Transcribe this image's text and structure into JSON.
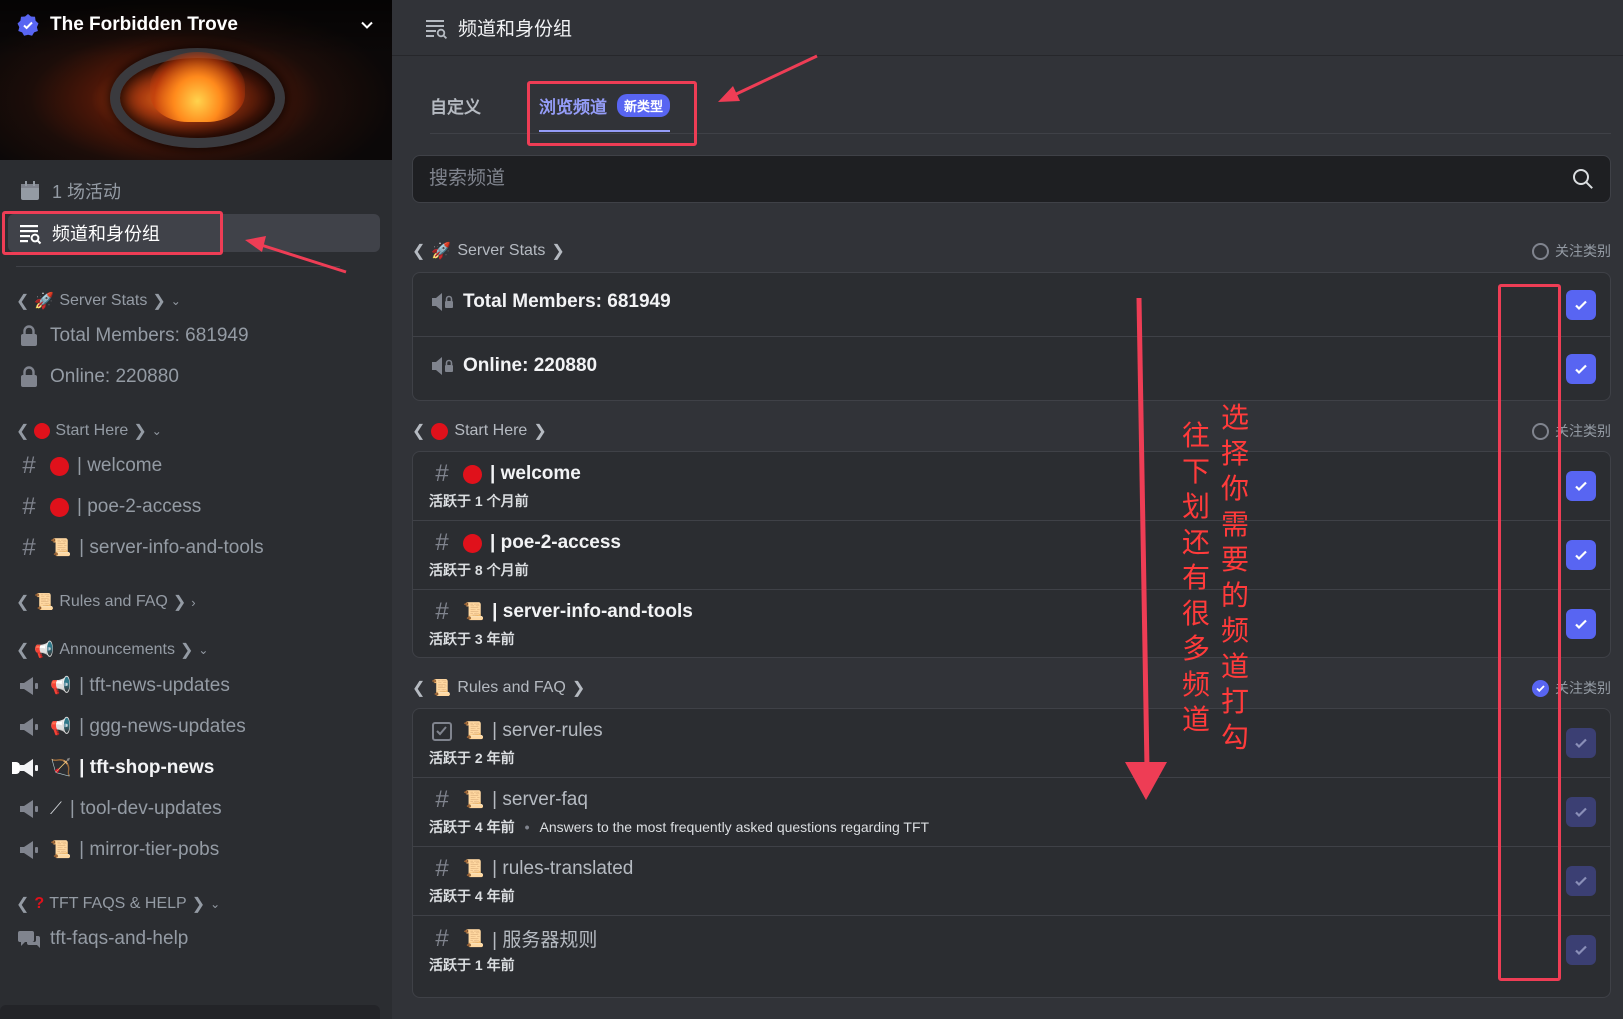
{
  "server": {
    "name": "The Forbidden Trove"
  },
  "sidebar": {
    "events_label": "1 场活动",
    "channels_roles_label": "频道和身份组",
    "categories": [
      {
        "name": "Server Stats",
        "emoji": "🚀",
        "channels": [
          {
            "name": "Total Members: 681949"
          },
          {
            "name": "Online: 220880"
          }
        ]
      },
      {
        "name": "Start Here",
        "emoji": "🔴",
        "channels": [
          {
            "name": "| welcome"
          },
          {
            "name": "| poe-2-access"
          },
          {
            "name": "| server-info-and-tools"
          }
        ]
      },
      {
        "name": "Rules and FAQ",
        "emoji": "📜",
        "channels": []
      },
      {
        "name": "Announcements",
        "emoji": "📢",
        "channels": [
          {
            "name": "| tft-news-updates"
          },
          {
            "name": "| ggg-news-updates"
          },
          {
            "name": "| tft-shop-news"
          },
          {
            "name": "| tool-dev-updates"
          },
          {
            "name": "| mirror-tier-pobs"
          }
        ]
      },
      {
        "name": "TFT FAQS & HELP",
        "emoji": "❓",
        "channels": [
          {
            "name": "tft-faqs-and-help"
          }
        ]
      }
    ]
  },
  "main": {
    "title": "频道和身份组",
    "tabs": {
      "custom": "自定义",
      "browse": "浏览频道",
      "new_badge": "新类型"
    },
    "search_placeholder": "搜索频道",
    "follow_label": "关注类别",
    "categories": [
      {
        "name": "Server Stats",
        "emoji": "🚀",
        "channels": [
          {
            "name": "Total Members: 681949"
          },
          {
            "name": "Online: 220880"
          }
        ]
      },
      {
        "name": "Start Here",
        "emoji": "🔴",
        "channels": [
          {
            "name": "| welcome",
            "activity": "活跃于 1 个月前"
          },
          {
            "name": "| poe-2-access",
            "activity": "活跃于 8 个月前"
          },
          {
            "name": "| server-info-and-tools",
            "activity": "活跃于 3 年前"
          }
        ]
      },
      {
        "name": "Rules and FAQ",
        "emoji": "📜",
        "channels": [
          {
            "name": "| server-rules",
            "activity": "活跃于 2 年前"
          },
          {
            "name": "| server-faq",
            "activity": "活跃于 4 年前",
            "description": "Answers to the most frequently asked questions regarding TFT"
          },
          {
            "name": "| rules-translated",
            "activity": "活跃于 4 年前"
          },
          {
            "name": "| 服务器规则",
            "activity": "活跃于 1 年前"
          }
        ]
      }
    ]
  },
  "annotations": {
    "note_scroll": "往下划还有很多频道",
    "note_select": "选择你需要的频道打勾"
  },
  "colors": {
    "accent": "#5865f2",
    "annotation": "#ee3d55",
    "sidebar_bg": "#2b2d31",
    "main_bg": "#313338"
  }
}
